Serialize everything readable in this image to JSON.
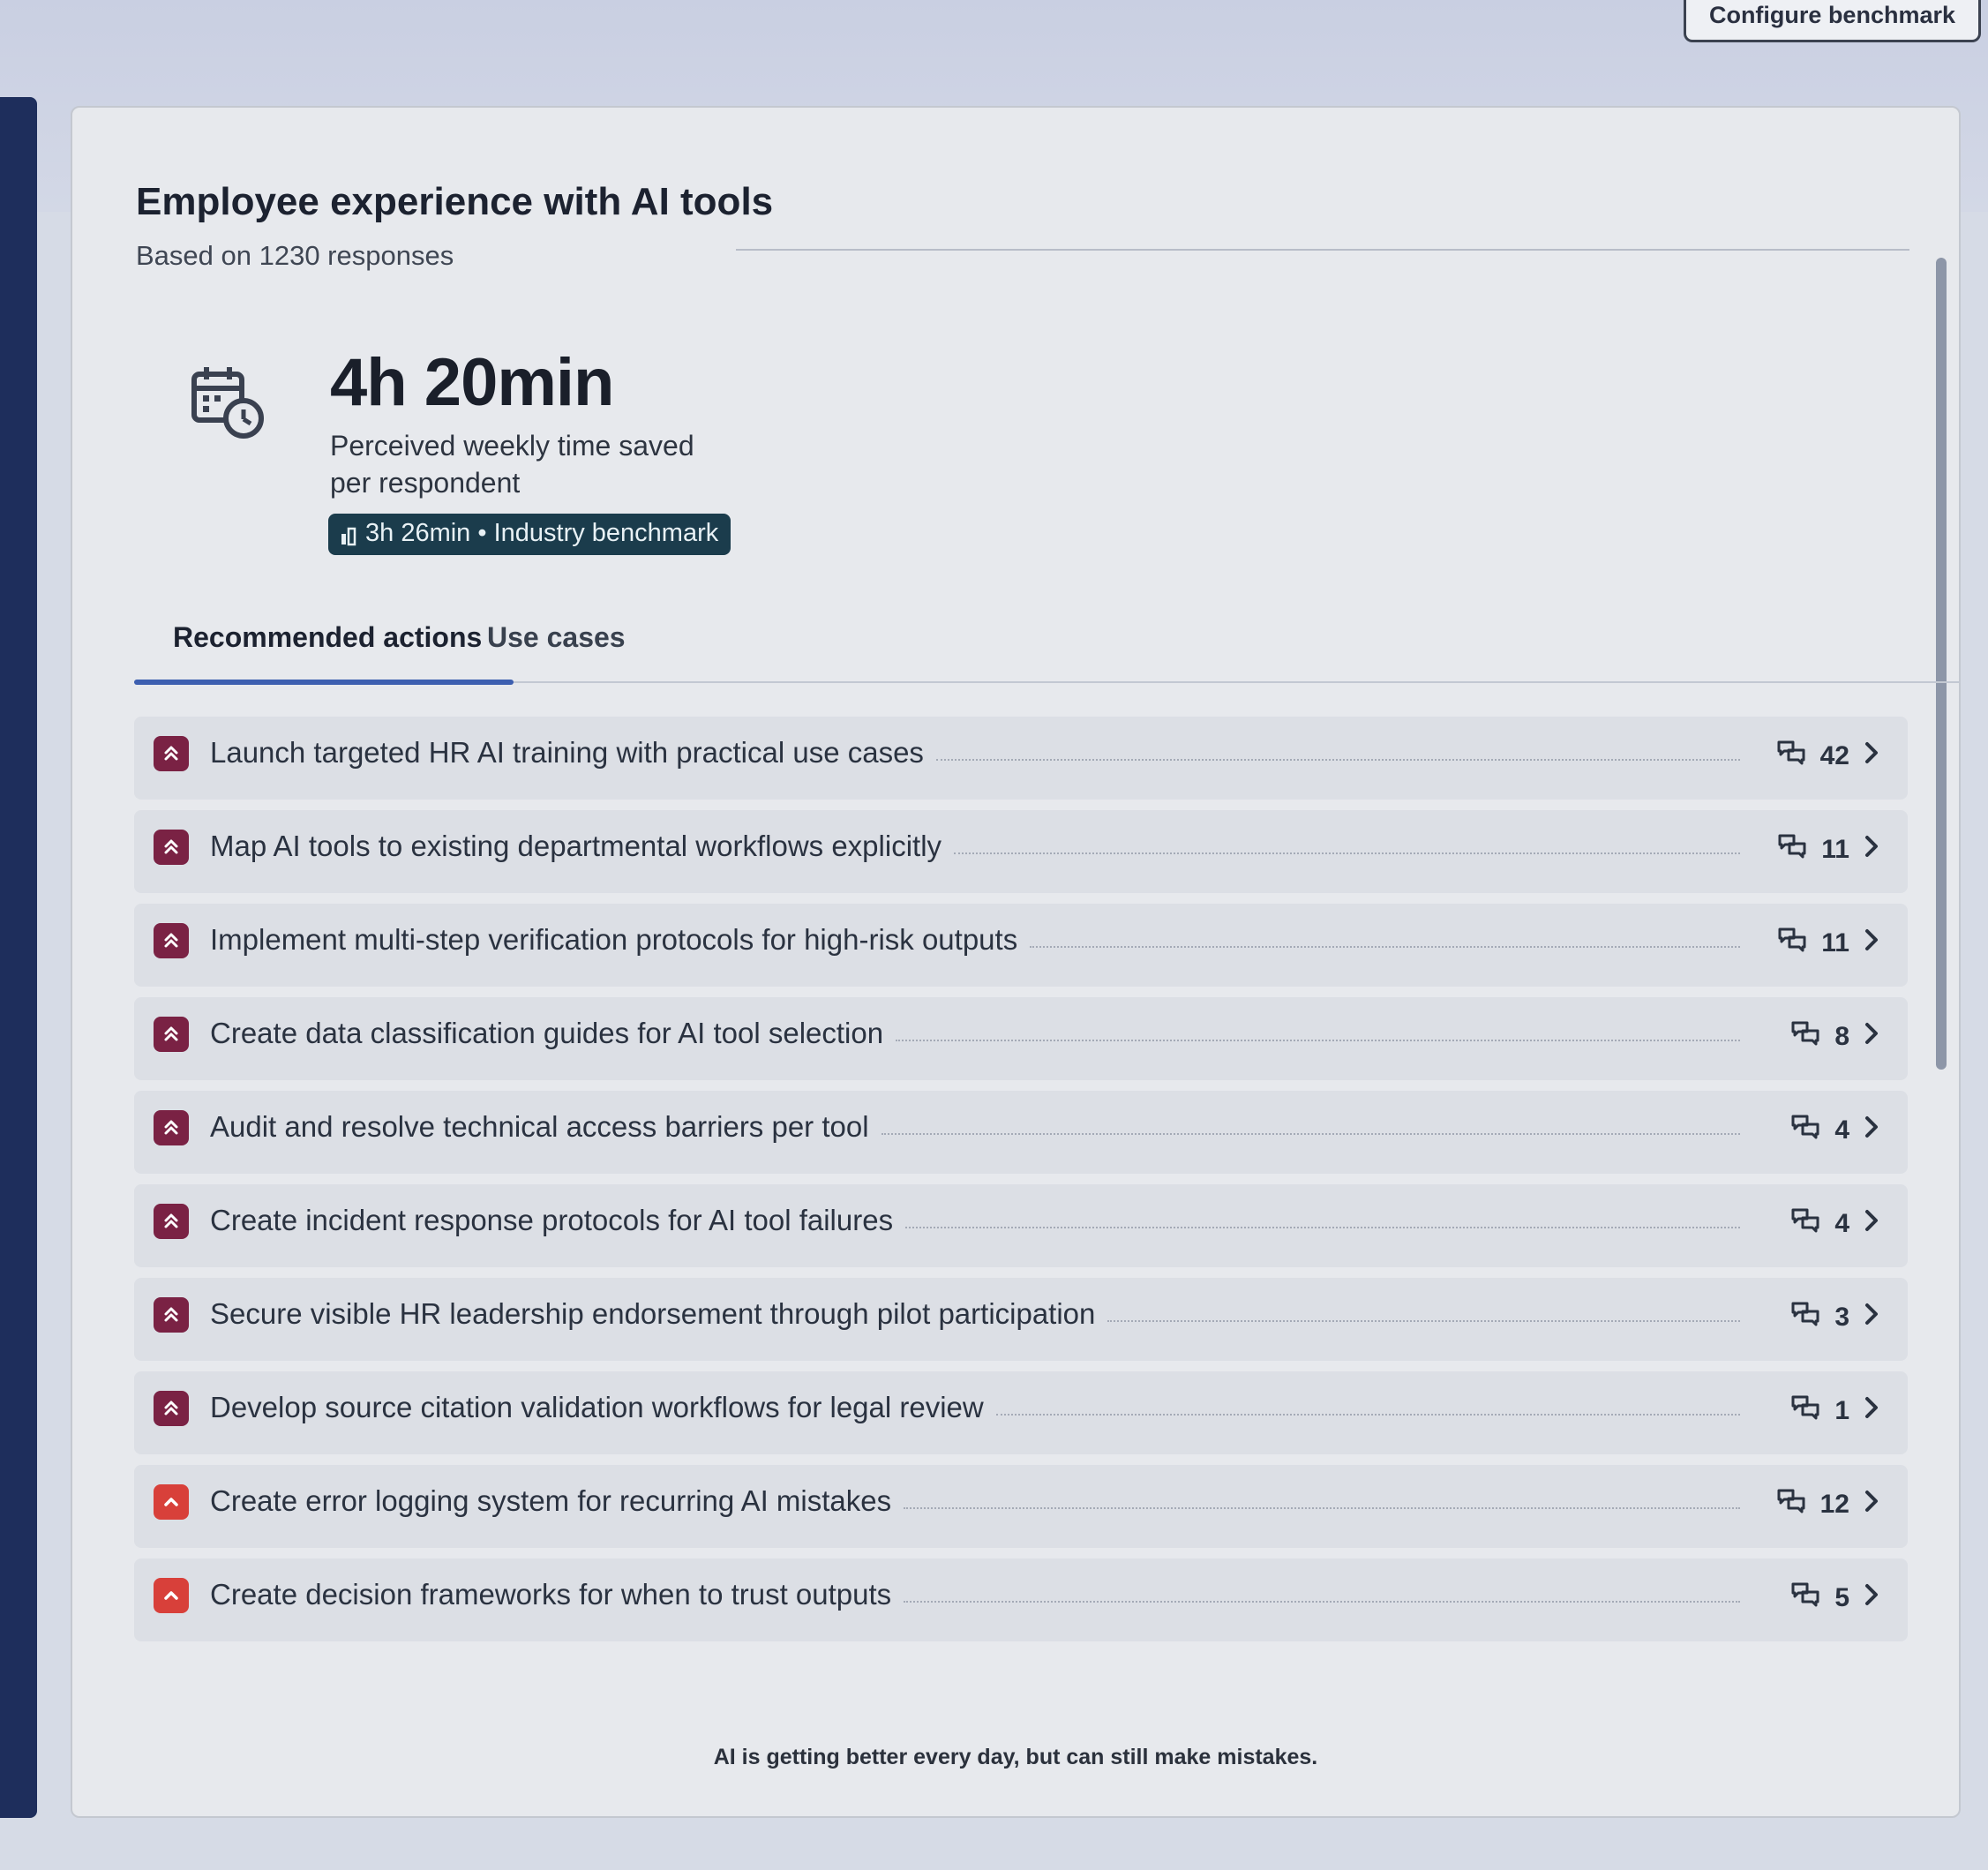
{
  "header": {
    "configure_label": "Configure benchmark"
  },
  "card": {
    "title": "Employee experience with AI tools",
    "subtitle": "Based on 1230 responses"
  },
  "metric": {
    "icon": "calendar-clock-icon",
    "value": "4h 20min",
    "label": "Perceived weekly time saved per respondent",
    "benchmark": "3h 26min • Industry benchmark"
  },
  "tabs": [
    {
      "label": "Recommended actions",
      "active": true
    },
    {
      "label": "Use cases",
      "active": false
    }
  ],
  "colors": {
    "accent": "#3d5fb0",
    "priority_high": "#7a2244",
    "priority_critical": "#d8403a",
    "badge_bg": "#1b3c4c"
  },
  "actions": [
    {
      "label": "Launch targeted HR AI training with practical use cases",
      "count": "42",
      "priority": "high",
      "icon": "double-chevron-up-icon"
    },
    {
      "label": "Map AI tools to existing departmental workflows explicitly",
      "count": "11",
      "priority": "high",
      "icon": "double-chevron-up-icon"
    },
    {
      "label": "Implement multi-step verification protocols for high-risk outputs",
      "count": "11",
      "priority": "high",
      "icon": "double-chevron-up-icon"
    },
    {
      "label": "Create data classification guides for AI tool selection",
      "count": "8",
      "priority": "high",
      "icon": "double-chevron-up-icon"
    },
    {
      "label": "Audit and resolve technical access barriers per tool",
      "count": "4",
      "priority": "high",
      "icon": "double-chevron-up-icon"
    },
    {
      "label": "Create incident response protocols for AI tool failures",
      "count": "4",
      "priority": "high",
      "icon": "double-chevron-up-icon"
    },
    {
      "label": "Secure visible HR leadership endorsement through pilot participation",
      "count": "3",
      "priority": "high",
      "icon": "double-chevron-up-icon"
    },
    {
      "label": "Develop source citation validation workflows for legal review",
      "count": "1",
      "priority": "high",
      "icon": "double-chevron-up-icon"
    },
    {
      "label": "Create error logging system for recurring AI mistakes",
      "count": "12",
      "priority": "critical",
      "icon": "chevron-up-icon"
    },
    {
      "label": "Create decision frameworks for when to trust outputs",
      "count": "5",
      "priority": "critical",
      "icon": "chevron-up-icon"
    }
  ],
  "footnote": "AI is getting better every day, but can still make mistakes."
}
